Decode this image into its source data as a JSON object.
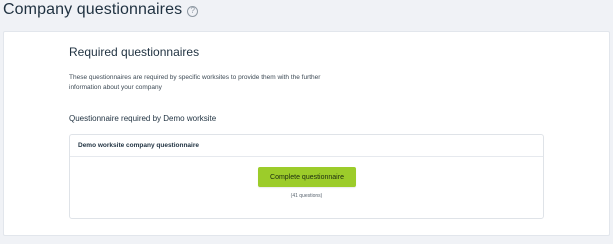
{
  "page": {
    "title": "Company questionnaires",
    "help_icon_glyph": "?"
  },
  "required": {
    "title": "Required questionnaires",
    "description": "These questionnaires are required by specific worksites to provide them with the further information about your company"
  },
  "group": {
    "title": "Questionnaire required by Demo worksite",
    "questionnaire": {
      "name": "Demo worksite company questionnaire",
      "button_label": "Complete questionnaire",
      "question_count": "(41 questions)"
    }
  },
  "colors": {
    "accent": "#9ccc2a",
    "background": "#f0f2f6"
  },
  "icons": {
    "help": "help-circle-icon"
  }
}
